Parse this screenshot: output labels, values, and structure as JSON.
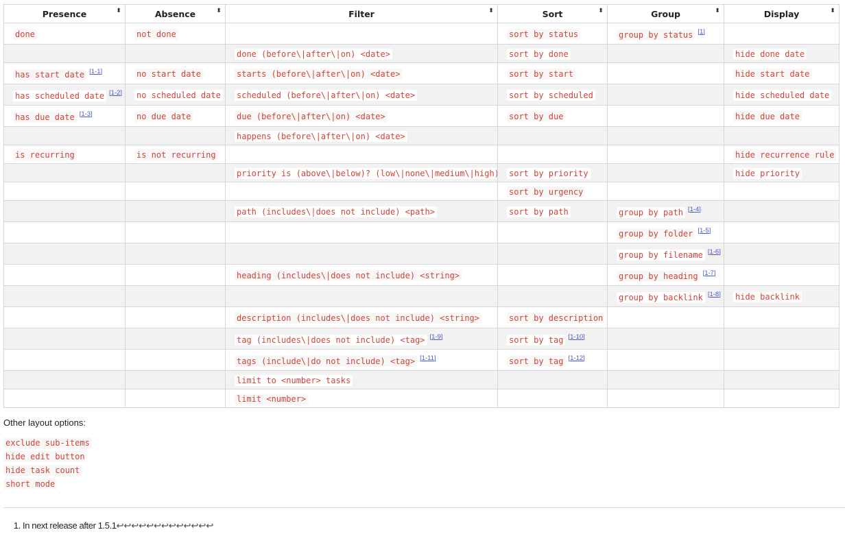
{
  "table": {
    "columns": [
      "Presence",
      "Absence",
      "Filter",
      "Sort",
      "Group",
      "Display"
    ],
    "sort_glyph": "⬍",
    "rows": [
      {
        "presence": "done",
        "absence": "not done",
        "filter": "",
        "sort": "sort by status",
        "group": "group by status",
        "group_fn": "[1]",
        "display": ""
      },
      {
        "presence": "",
        "absence": "",
        "filter": "done (before\\|after\\|on) <date>",
        "sort": "sort by done",
        "group": "",
        "display": "hide done date"
      },
      {
        "presence": "has start date",
        "presence_fn": "[1-1]",
        "absence": "no start date",
        "filter": "starts (before\\|after\\|on) <date>",
        "sort": "sort by start",
        "group": "",
        "display": "hide start date"
      },
      {
        "presence": "has scheduled date",
        "presence_fn": "[1-2]",
        "absence": "no scheduled date",
        "filter": "scheduled (before\\|after\\|on) <date>",
        "sort": "sort by scheduled",
        "group": "",
        "display": "hide scheduled date"
      },
      {
        "presence": "has due date",
        "presence_fn": "[1-3]",
        "absence": "no due date",
        "filter": "due (before\\|after\\|on) <date>",
        "sort": "sort by due",
        "group": "",
        "display": "hide due date"
      },
      {
        "presence": "",
        "absence": "",
        "filter": "happens (before\\|after\\|on) <date>",
        "sort": "",
        "group": "",
        "display": ""
      },
      {
        "presence": "is recurring",
        "absence": "is not recurring",
        "filter": "",
        "sort": "",
        "group": "",
        "display": "hide recurrence rule"
      },
      {
        "presence": "",
        "absence": "",
        "filter": "priority is (above\\|below)? (low\\|none\\|medium\\|high)",
        "sort": "sort by priority",
        "group": "",
        "display": "hide priority"
      },
      {
        "presence": "",
        "absence": "",
        "filter": "",
        "sort": "sort by urgency",
        "group": "",
        "display": ""
      },
      {
        "presence": "",
        "absence": "",
        "filter": "path (includes\\|does not include) <path>",
        "sort": "sort by path",
        "group": "group by path",
        "group_fn": "[1-4]",
        "display": ""
      },
      {
        "presence": "",
        "absence": "",
        "filter": "",
        "sort": "",
        "group": "group by folder",
        "group_fn": "[1-5]",
        "display": ""
      },
      {
        "presence": "",
        "absence": "",
        "filter": "",
        "sort": "",
        "group": "group by filename",
        "group_fn": "[1-6]",
        "display": ""
      },
      {
        "presence": "",
        "absence": "",
        "filter": "heading (includes\\|does not include) <string>",
        "sort": "",
        "group": "group by heading",
        "group_fn": "[1-7]",
        "display": ""
      },
      {
        "presence": "",
        "absence": "",
        "filter": "",
        "sort": "",
        "group": "group by backlink",
        "group_fn": "[1-8]",
        "display": "hide backlink"
      },
      {
        "presence": "",
        "absence": "",
        "filter": "description (includes\\|does not include) <string>",
        "sort": "sort by description",
        "group": "",
        "display": ""
      },
      {
        "presence": "",
        "absence": "",
        "filter": "tag (includes\\|does not include) <tag>",
        "filter_fn": "[1-9]",
        "sort": "sort by tag",
        "sort_fn": "[1-10]",
        "group": "",
        "display": ""
      },
      {
        "presence": "",
        "absence": "",
        "filter": "tags (include\\|do not include) <tag>",
        "filter_fn": "[1-11]",
        "sort": "sort by tag",
        "sort_fn": "[1-12]",
        "group": "",
        "display": ""
      },
      {
        "presence": "",
        "absence": "",
        "filter": "limit to <number> tasks",
        "sort": "",
        "group": "",
        "display": ""
      },
      {
        "presence": "",
        "absence": "",
        "filter": "limit <number>",
        "sort": "",
        "group": "",
        "display": ""
      }
    ]
  },
  "other_layout": {
    "title": "Other layout options:",
    "options": [
      "exclude sub-items",
      "hide edit button",
      "hide task count",
      "short mode"
    ]
  },
  "footnotes": {
    "items": [
      {
        "text": "In next release after 1.5.1",
        "backrefs": "↩︎↩︎↩︎↩︎↩︎↩︎↩︎↩︎↩︎↩︎↩︎↩︎↩︎"
      }
    ]
  }
}
